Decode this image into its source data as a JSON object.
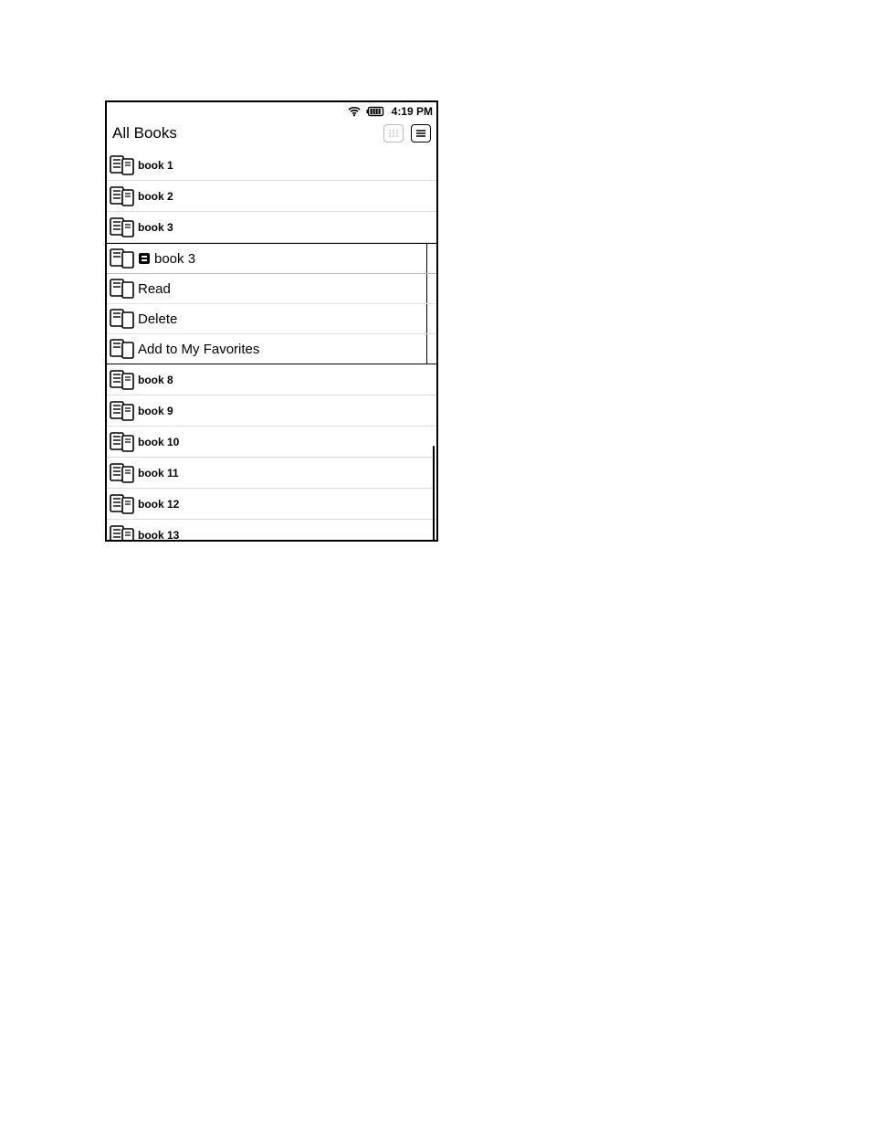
{
  "status_bar": {
    "time": "4:19 PM"
  },
  "header": {
    "title": "All Books"
  },
  "books": {
    "b1": "book 1",
    "b2": "book 2",
    "b3": "book 3",
    "b8": "book 8",
    "b9": "book 9",
    "b10": "book 10",
    "b11": "book 11",
    "b12": "book 12",
    "b13": "book 13"
  },
  "context_menu": {
    "title": "book 3",
    "items": {
      "read": "Read",
      "delete": "Delete",
      "add_fav": "Add to My Favorites"
    }
  }
}
